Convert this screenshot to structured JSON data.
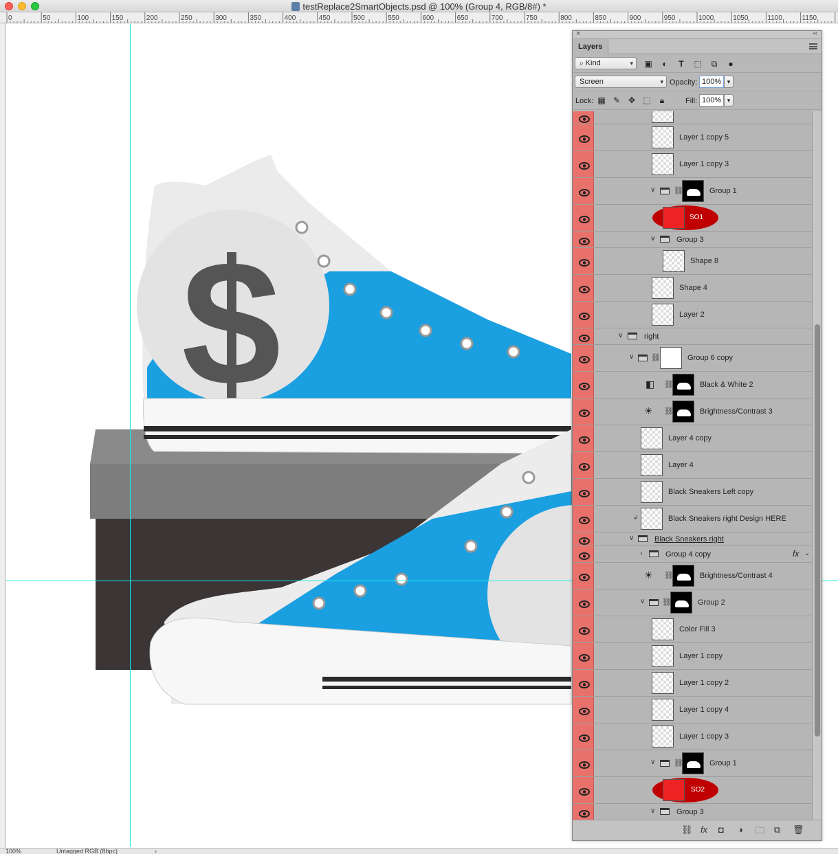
{
  "window": {
    "title": "testReplace2SmartObjects.psd @ 100% (Group 4, RGB/8#) *"
  },
  "ruler_labels": [
    "0",
    "50",
    "100",
    "150",
    "200",
    "250",
    "300",
    "350",
    "400",
    "450",
    "500",
    "550",
    "600",
    "650",
    "700",
    "750",
    "800",
    "850",
    "900",
    "950",
    "1000",
    "1050",
    "1100",
    "1150"
  ],
  "status": {
    "zoom": "100%",
    "profile": "Untagged RGB (8bpc)",
    "arrow": "›"
  },
  "panel": {
    "title": "Layers",
    "close": "×",
    "collapse": "‹‹",
    "filter_kind": "Kind",
    "blend_mode": "Screen",
    "opacity_label": "Opacity:",
    "opacity_value": "100%",
    "lock_label": "Lock:",
    "fill_label": "Fill:",
    "fill_value": "100%"
  },
  "layers": [
    {
      "name": "Layer 1 copy 5"
    },
    {
      "name": "Layer 1 copy 3"
    },
    {
      "name": "Group 1"
    },
    {
      "name": "SO1"
    },
    {
      "name": "Group 3"
    },
    {
      "name": "Shape 8"
    },
    {
      "name": "Shape 4"
    },
    {
      "name": "Layer 2"
    },
    {
      "name": "right"
    },
    {
      "name": "Group 6 copy"
    },
    {
      "name": "Black & White 2"
    },
    {
      "name": "Brightness/Contrast 3"
    },
    {
      "name": "Layer 4 copy"
    },
    {
      "name": "Layer 4"
    },
    {
      "name": "Black Sneakers Left copy"
    },
    {
      "name": "Black Sneakers right Design HERE"
    },
    {
      "name": "Black Sneakers right"
    },
    {
      "name": "Group 4 copy",
      "fx": "fx"
    },
    {
      "name": "Brightness/Contrast 4"
    },
    {
      "name": "Group 2"
    },
    {
      "name": "Color Fill 3"
    },
    {
      "name": "Layer 1 copy"
    },
    {
      "name": "Layer 1 copy 2"
    },
    {
      "name": "Layer 1 copy 4"
    },
    {
      "name": "Layer 1 copy 3"
    },
    {
      "name": "Group 1"
    },
    {
      "name": "SO2"
    },
    {
      "name": "Group 3"
    }
  ],
  "colors": {
    "eye_column": "#e8716b",
    "guide": "#11eeee",
    "smart_object_highlight": "#c00000",
    "shoe_blue": "#1a9fe0"
  }
}
